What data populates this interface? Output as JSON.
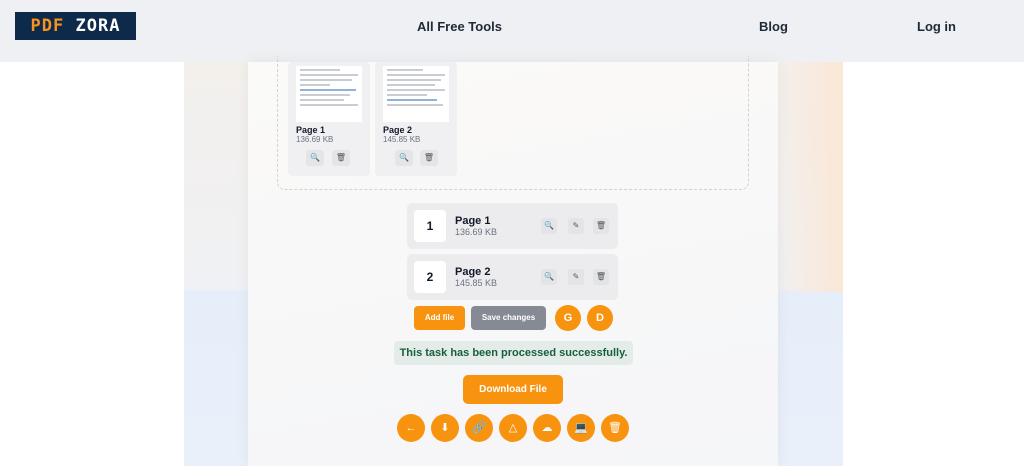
{
  "header": {
    "logo_left": "PDF",
    "logo_right": "ZORA",
    "nav": {
      "tools": "All Free Tools",
      "blog": "Blog",
      "login": "Log in"
    }
  },
  "thumbnails": [
    {
      "name": "Page 1",
      "size": "136.69 KB"
    },
    {
      "name": "Page 2",
      "size": "145.85 KB"
    }
  ],
  "pages": [
    {
      "number": "1",
      "name": "Page 1",
      "size": "136.69 KB"
    },
    {
      "number": "2",
      "name": "Page 2",
      "size": "145.85 KB"
    }
  ],
  "actions": {
    "add_file": "Add file",
    "save_changes": "Save changes",
    "google_drive": "G",
    "dropbox": "D"
  },
  "status": {
    "message": "This task has been processed successfully."
  },
  "download": {
    "label": "Download File"
  },
  "icons": {
    "zoom": "🔍",
    "edit": "✎",
    "delete": "🗑",
    "back": "←",
    "download": "⬇",
    "link": "🔗",
    "gdrive": "△",
    "cloud": "☁",
    "computer": "💻",
    "trash": "🗑"
  },
  "colors": {
    "accent": "#f7930f",
    "gray_button": "#858a94",
    "success_text": "#17603b",
    "header_bg": "#eef0f4"
  }
}
